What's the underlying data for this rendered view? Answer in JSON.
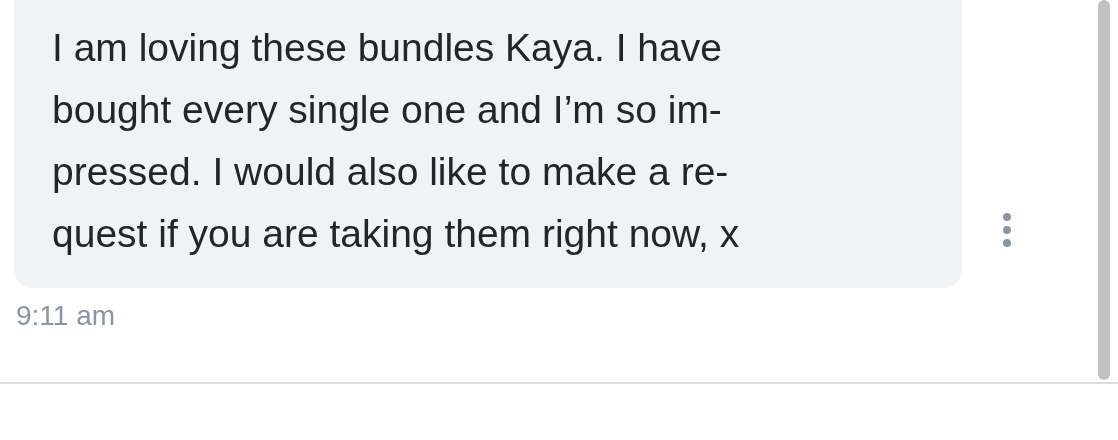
{
  "message": {
    "text": "I am loving these bundles Kaya. I have\nbought every single one and I’m so im-\npressed. I would also like to make a re-\nquest if you are taking them right now, x",
    "time": "9:11 am"
  }
}
